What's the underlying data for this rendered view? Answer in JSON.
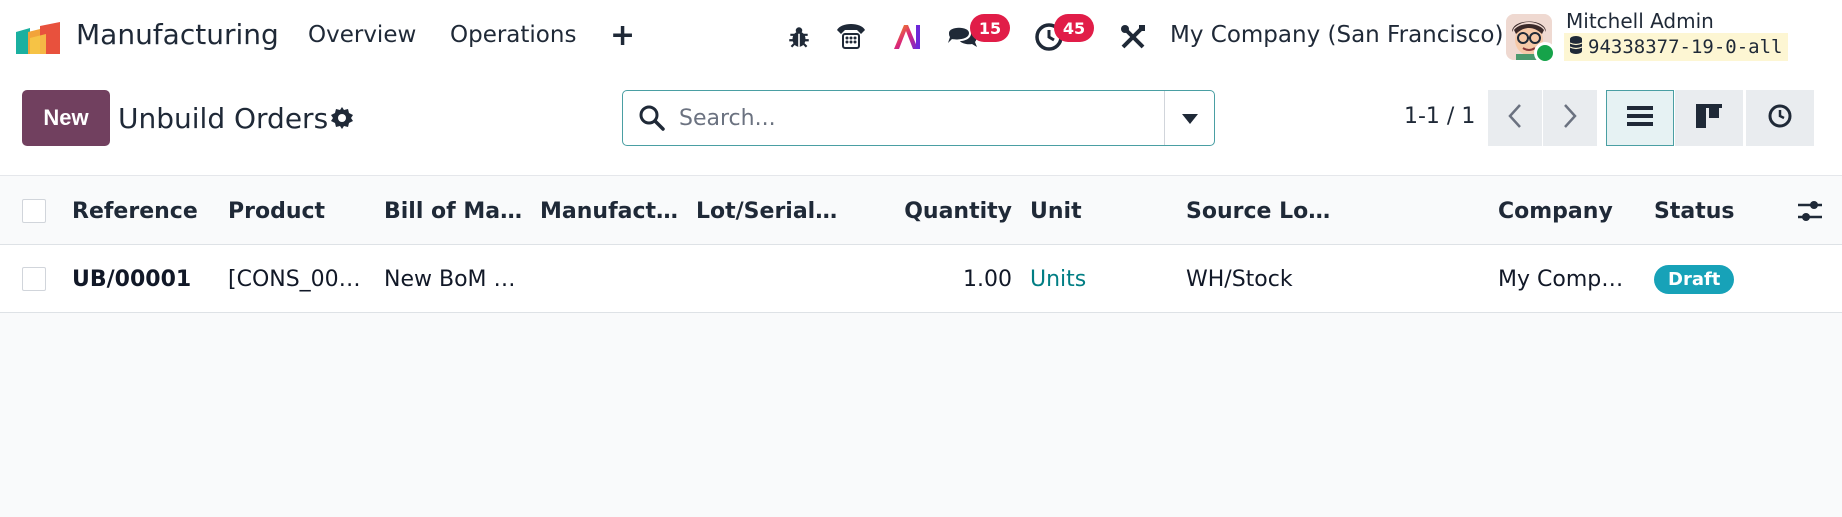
{
  "navbar": {
    "app_name": "Manufacturing",
    "menu": [
      "Overview",
      "Operations"
    ],
    "plus": "+",
    "icons": [
      "bug-icon",
      "phone-icon",
      "ai-icon",
      "chat-icon",
      "activity-clock-icon",
      "tools-icon"
    ],
    "messages_badge": "15",
    "activities_badge": "45",
    "company": "My Company (San Francisco)",
    "user_name": "Mitchell Admin",
    "database": "94338377-19-0-all"
  },
  "control": {
    "new_label": "New",
    "title": "Unbuild Orders",
    "search_placeholder": "Search...",
    "pager": "1-1 / 1"
  },
  "table": {
    "columns": [
      "Reference",
      "Product",
      "Bill of Ma…",
      "Manufact…",
      "Lot/Serial…",
      "Quantity",
      "Unit",
      "Source Lo…",
      "Company",
      "Status"
    ],
    "rows": [
      {
        "reference": "UB/00001",
        "product": "[CONS_00…",
        "bom": "New BoM …",
        "manufacturing": "",
        "lot": "",
        "quantity": "1.00",
        "unit": "Units",
        "source_location": "WH/Stock",
        "company": "My Comp…",
        "status": "Draft"
      }
    ]
  },
  "colors": {
    "brand": "#71405f",
    "accent": "#017e84",
    "badge": "#e11d48",
    "status_draft": "#17a2b8"
  }
}
